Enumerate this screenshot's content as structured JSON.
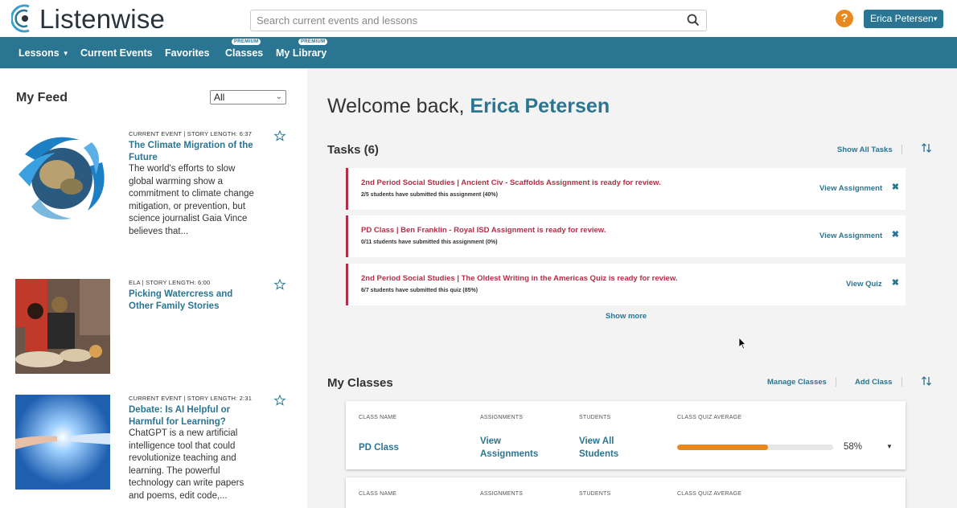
{
  "header": {
    "logo_text": "Listenwise",
    "search_placeholder": "Search current events and lessons",
    "help_label": "?",
    "user_name": "Erica Petersen"
  },
  "nav": {
    "items": [
      {
        "label": "Lessons"
      },
      {
        "label": "Current Events"
      },
      {
        "label": "Favorites"
      },
      {
        "label": "Classes",
        "badge": "PREMIUM"
      },
      {
        "label": "My Library",
        "badge": "PREMIUM"
      }
    ]
  },
  "feed": {
    "title": "My Feed",
    "filter_value": "All",
    "stories": [
      {
        "meta": "CURRENT EVENT | STORY LENGTH: 6:37",
        "title": "The Climate Migration of the Future",
        "description": "The world's efforts to slow global warming show a commitment to climate change mitigation, or prevention, but science journalist Gaia Vince believes that..."
      },
      {
        "meta": "ELA | STORY LENGTH: 6:00",
        "title": "Picking Watercress and Other Family Stories",
        "description": ""
      },
      {
        "meta": "CURRENT EVENT | STORY LENGTH: 2:31",
        "title": "Debate: Is AI Helpful or Harmful for Learning?",
        "description": "ChatGPT is a new artificial intelligence tool that could revolutionize teaching and learning. The powerful technology can write papers and poems, edit code,..."
      }
    ]
  },
  "main": {
    "welcome_prefix": "Welcome back,",
    "welcome_name": "Erica Petersen",
    "tasks": {
      "title": "Tasks (6)",
      "show_all": "Show All Tasks",
      "items": [
        {
          "title": "2nd Period Social Studies | Ancient Civ - Scaffolds Assignment is ready for review.",
          "subtitle": "2/5 students have submitted this assignment (40%)",
          "action": "View Assignment"
        },
        {
          "title": "PD Class | Ben Franklin - Royal ISD Assignment is ready for review.",
          "subtitle": "0/11 students have submitted this assignment (0%)",
          "action": "View Assignment"
        },
        {
          "title": "2nd Period Social Studies | The Oldest Writing in the Americas Quiz is ready for review.",
          "subtitle": "6/7 students have submitted this quiz (85%)",
          "action": "View Quiz"
        }
      ],
      "close_glyph": "✖",
      "show_more": "Show more"
    },
    "classes": {
      "title": "My Classes",
      "manage": "Manage Classes",
      "add": "Add Class",
      "headers": {
        "class_name": "CLASS NAME",
        "assignments": "ASSIGNMENTS",
        "students": "STUDENTS",
        "average": "CLASS QUIZ AVERAGE"
      },
      "rows": [
        {
          "name": "PD Class",
          "assignments_link": "View Assignments",
          "students_link": "View All Students",
          "average_pct": "58%",
          "average_value": 0.58
        }
      ]
    }
  },
  "colors": {
    "brand": "#2a7592",
    "alert": "#b52e47",
    "accent": "#e8891f"
  }
}
